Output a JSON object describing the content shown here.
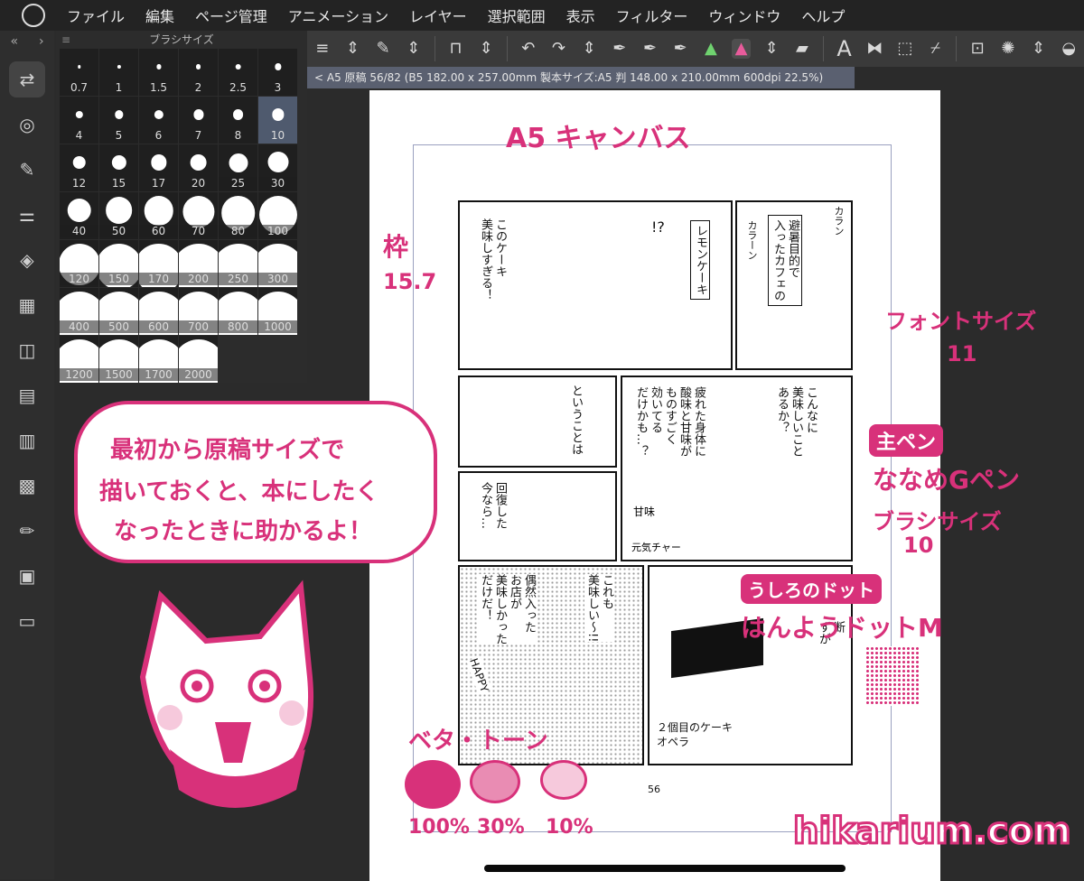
{
  "menu": {
    "items": [
      "ファイル",
      "編集",
      "ページ管理",
      "アニメーション",
      "レイヤー",
      "選択範囲",
      "表示",
      "フィルター",
      "ウィンドウ",
      "ヘルプ"
    ]
  },
  "toolbar": {
    "icons": [
      "menu-icon",
      "stepper-icon",
      "edit-icon",
      "stepper-icon",
      "snap-icon",
      "stepper-icon",
      "undo-icon",
      "redo-icon",
      "stepper-icon",
      "pen-icon",
      "pen-icon",
      "pen-icon",
      "color-layer-icon",
      "color-layer-icon-active",
      "stepper-icon",
      "eraser-icon",
      "text-icon",
      "flip-icon",
      "selection-icon",
      "eyedropper-icon",
      "transform-icon",
      "loading-icon",
      "stepper-icon",
      "fill-icon"
    ],
    "text_tool_glyph": "A"
  },
  "brush_panel": {
    "title": "ブラシサイズ",
    "sizes": [
      "0.7",
      "1",
      "1.5",
      "2",
      "2.5",
      "3",
      "4",
      "5",
      "6",
      "7",
      "8",
      "10",
      "12",
      "15",
      "17",
      "20",
      "25",
      "30",
      "40",
      "50",
      "60",
      "70",
      "80",
      "100",
      "120",
      "150",
      "170",
      "200",
      "250",
      "300",
      "400",
      "500",
      "600",
      "700",
      "800",
      "1000",
      "1200",
      "1500",
      "1700",
      "2000"
    ],
    "selected": "10"
  },
  "status": {
    "text": "< A5 原稿 56/82 (B5 182.00 x 257.00mm 製本サイズ:A5 判 148.00 x 210.00mm 600dpi 22.5%)"
  },
  "page": {
    "number": "56",
    "panels": {
      "p1_line1": "このケーキ\n美味しすぎる！",
      "p1_line2": "レモンケーキ",
      "p1_exclaim": "!?",
      "p2_line1": "カラン",
      "p2_line2": "避暑目的で\n入ったカフェの",
      "p2_line3": "カラーン",
      "p3_line1": "ということは",
      "p4_line1": "疲れた身体に\n酸味と甘味が\nものすごく\n効いてる\nだけかも…？",
      "p4_line2": "こんなに\n美味しいこと\nあるか？",
      "p4_label_a": "甘味",
      "p4_label_b": "元気チャー",
      "p5_line1": "回復した\n今なら…",
      "p6_line1": "偶然入った\nお店が\n美味しかった\nだけだ！",
      "p6_line2": "これも\n美味しい〜!!",
      "p6_happy": "HAPPY",
      "p7_line1": "断\nずが",
      "p7_line2": "２個目のケーキ\nオペラ"
    }
  },
  "annotations": {
    "canvas": "A5 キャンバス",
    "frame_label": "枠",
    "frame_value": "15.7",
    "font_label": "フォントサイズ",
    "font_value": "11",
    "main_pen_label": "主ペン",
    "pen_name": "ななめGペン",
    "brush_label": "ブラシサイズ",
    "brush_value": "10",
    "dots_label": "うしろのドット",
    "dots_name": "はんようドットM",
    "tone_label": "ベタ・トーン",
    "tone_values": [
      "100%",
      "30%",
      "10%"
    ],
    "bubble_lines": [
      "最初から原稿サイズで",
      "描いておくと、本にしたく",
      "なったときに助かるよ！"
    ],
    "watermark": "hikarium.com"
  },
  "colors": {
    "accent_pink": "#d8317a",
    "tone_30": "#e98cb3",
    "tone_10": "#f6c9dc"
  }
}
